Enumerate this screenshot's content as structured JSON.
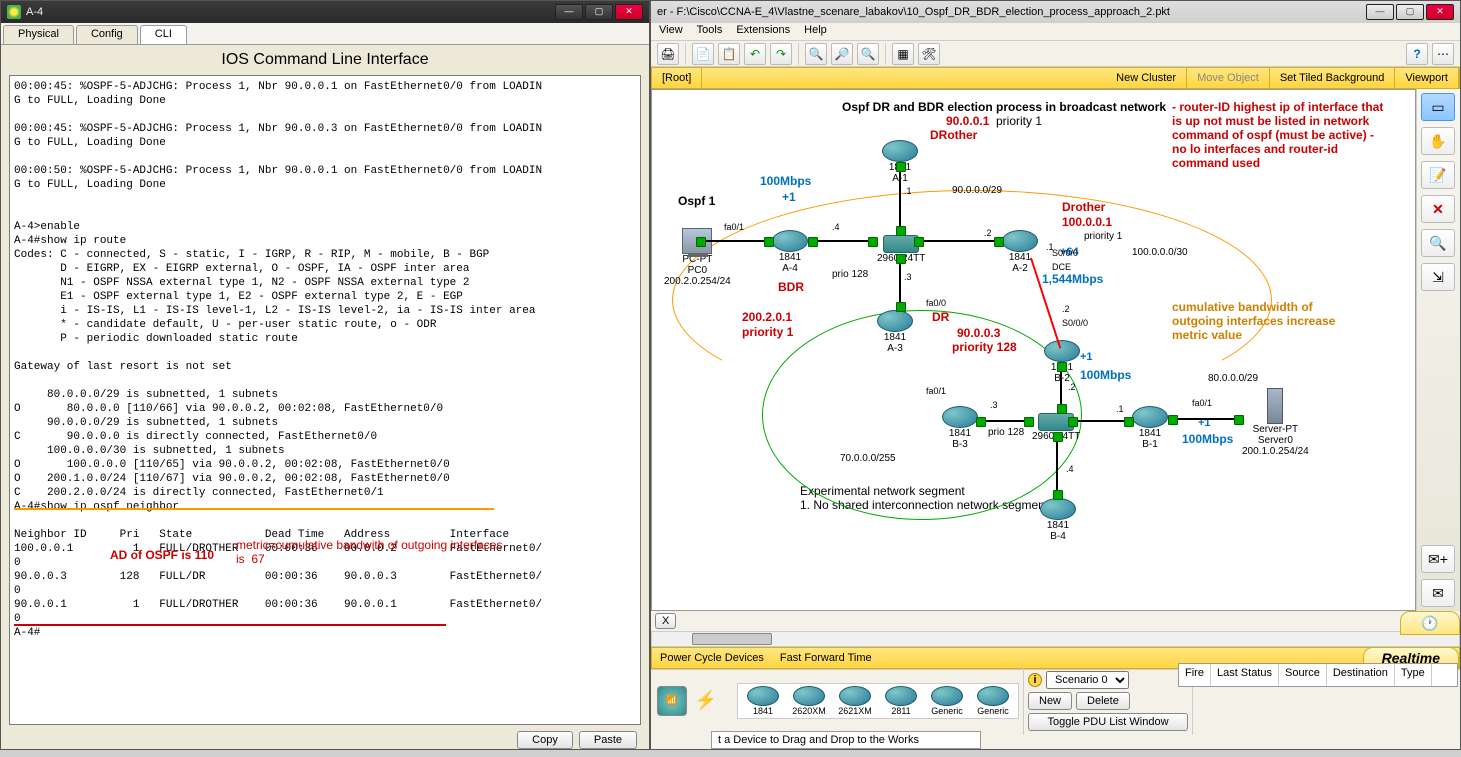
{
  "leftWindow": {
    "title": "A-4",
    "tabs": [
      "Physical",
      "Config",
      "CLI"
    ],
    "activeTab": "CLI",
    "heading": "IOS Command Line Interface",
    "cliText": "00:00:45: %OSPF-5-ADJCHG: Process 1, Nbr 90.0.0.1 on FastEthernet0/0 from LOADIN\nG to FULL, Loading Done\n\n00:00:45: %OSPF-5-ADJCHG: Process 1, Nbr 90.0.0.3 on FastEthernet0/0 from LOADIN\nG to FULL, Loading Done\n\n00:00:50: %OSPF-5-ADJCHG: Process 1, Nbr 90.0.0.1 on FastEthernet0/0 from LOADIN\nG to FULL, Loading Done\n\n\nA-4>enable\nA-4#show ip route\nCodes: C - connected, S - static, I - IGRP, R - RIP, M - mobile, B - BGP\n       D - EIGRP, EX - EIGRP external, O - OSPF, IA - OSPF inter area\n       N1 - OSPF NSSA external type 1, N2 - OSPF NSSA external type 2\n       E1 - OSPF external type 1, E2 - OSPF external type 2, E - EGP\n       i - IS-IS, L1 - IS-IS level-1, L2 - IS-IS level-2, ia - IS-IS inter area\n       * - candidate default, U - per-user static route, o - ODR\n       P - periodic downloaded static route\n\nGateway of last resort is not set\n\n     80.0.0.0/29 is subnetted, 1 subnets\nO       80.0.0.0 [110/66] via 90.0.0.2, 00:02:08, FastEthernet0/0\n     90.0.0.0/29 is subnetted, 1 subnets\nC       90.0.0.0 is directly connected, FastEthernet0/0\n     100.0.0.0/30 is subnetted, 1 subnets\nO       100.0.0.0 [110/65] via 90.0.0.2, 00:02:08, FastEthernet0/0\nO    200.1.0.0/24 [110/67] via 90.0.0.2, 00:02:08, FastEthernet0/0\nC    200.2.0.0/24 is directly connected, FastEthernet0/1\nA-4#show ip ospf neighbor\n\nNeighbor ID     Pri   State           Dead Time   Address         Interface\n100.0.0.1         1   FULL/DROTHER    00:00:36    90.0.0.2        FastEthernet0/\n0\n90.0.0.3        128   FULL/DR         00:00:36    90.0.0.3        FastEthernet0/\n0\n90.0.0.1          1   FULL/DROTHER    00:00:36    90.0.0.1        FastEthernet0/\n0\nA-4#",
    "annotations": {
      "adOspf": "AD of OSPF is 110",
      "metricNote": "metric=cumulative bandwith of outgoing interfaces\nis  67"
    },
    "buttons": {
      "copy": "Copy",
      "paste": "Paste"
    }
  },
  "rightWindow": {
    "title": "er - F:\\Cisco\\CCNA-E_4\\Vlastne_scenare_labakov\\10_Ospf_DR_BDR_election_process_approach_2.pkt",
    "menus": [
      "View",
      "Tools",
      "Extensions",
      "Help"
    ],
    "yellowbar": {
      "root": "[Root]",
      "newCluster": "New Cluster",
      "moveObject": "Move Object",
      "setTiled": "Set Tiled Background",
      "viewport": "Viewport"
    },
    "topology": {
      "title": "Ospf DR and BDR election process in broadcast network",
      "ospfLabel": "Ospf 1",
      "routerIdNote": "- router-ID highest ip of interface that is up not must be listed in network command of ospf (must be active) - no lo interfaces and router-id command used",
      "cumulativeNote": "cumulative bandwidth of outgoing interfaces increase metric value",
      "experimentalNote": "Experimental network segment\n1. No shared interconnection network segment",
      "devices": {
        "A1": {
          "model": "1841",
          "name": "A-1",
          "note": "DRother",
          "ip": "90.0.0.1",
          "prio": "priority 1"
        },
        "A2": {
          "model": "1841",
          "name": "A-2",
          "note": "Drother",
          "ip": "100.0.0.1",
          "prio": "priority 1",
          "serial": "S0/0/0\nDCE",
          "speed": "1,544Mbps",
          "cost": "+64"
        },
        "A3": {
          "model": "1841",
          "name": "A-3",
          "note": "DR",
          "ip": "90.0.0.3",
          "prio": "priority 128"
        },
        "A4": {
          "model": "1841",
          "name": "A-4",
          "note": "BDR",
          "ip": "200.2.0.1",
          "prio": "priority 1",
          "speed": "100Mbps",
          "cost": "+1"
        },
        "B1": {
          "model": "1841",
          "name": "B-1",
          "speed": "100Mbps",
          "cost": "+1"
        },
        "B2": {
          "model": "1841",
          "name": "B-2",
          "speed": "100Mbps",
          "cost": "+1",
          "serial": "S0/0/0"
        },
        "B3": {
          "model": "1841",
          "name": "B-3",
          "prio": "prio 128"
        },
        "B4": {
          "model": "1841",
          "name": "B-4"
        },
        "SW1": {
          "model": "2960 24TT",
          "prio": "prio 128"
        },
        "SW2": {
          "model": "2960 24TT"
        },
        "PC0": {
          "model": "PC-PT",
          "name": "PC0",
          "net": "200.2.0.254/24"
        },
        "SRV0": {
          "model": "Server-PT",
          "name": "Server0",
          "net": "200.1.0.254/24"
        }
      },
      "nets": {
        "n90": "90.0.0.0/29",
        "n100": "100.0.0.0/30",
        "n80": "80.0.0.0/29",
        "n70": "70.0.0.0/255"
      },
      "ifLabels": {
        "fa00": "fa0/0",
        "fa01": "fa0/1"
      }
    },
    "scrollX": "X",
    "bottombar": {
      "powerCycle": "Power Cycle Devices",
      "fastFwd": "Fast Forward Time",
      "realtime": "Realtime"
    },
    "scenario": {
      "label": "Scenario 0",
      "new": "New",
      "delete": "Delete",
      "toggle": "Toggle PDU List Window"
    },
    "pduHeaders": [
      "Fire",
      "Last Status",
      "Source",
      "Destination",
      "Type"
    ],
    "trayModels": [
      "1841",
      "2620XM",
      "2621XM",
      "2811",
      "Generic",
      "Generic"
    ],
    "dragHint": "t a Device to Drag and Drop to the Works"
  }
}
